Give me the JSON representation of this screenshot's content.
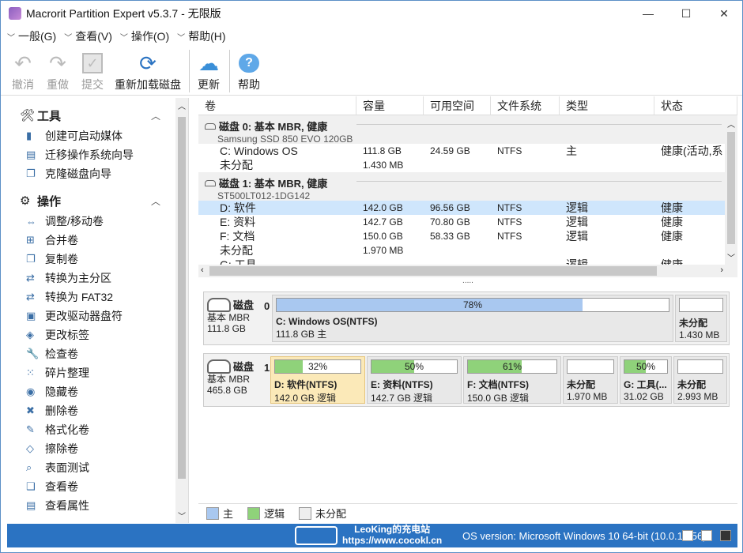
{
  "window": {
    "title": "Macrorit Partition Expert v5.3.7 - 无限版",
    "minimize": "—",
    "maximize": "☐",
    "close": "✕"
  },
  "menu": [
    {
      "label": "一般(G)"
    },
    {
      "label": "查看(V)"
    },
    {
      "label": "操作(O)"
    },
    {
      "label": "帮助(H)"
    }
  ],
  "toolbar": {
    "undo": "撤消",
    "redo": "重做",
    "commit": "提交",
    "reload": "重新加载磁盘",
    "update": "更新",
    "help": "帮助"
  },
  "sidebar": {
    "tools_title": "工具",
    "tools": [
      "创建可启动媒体",
      "迁移操作系统向导",
      "克隆磁盘向导"
    ],
    "ops_title": "操作",
    "ops": [
      "调整/移动卷",
      "合并卷",
      "复制卷",
      "转换为主分区",
      "转换为 FAT32",
      "更改驱动器盘符",
      "更改标签",
      "检查卷",
      "碎片整理",
      "隐藏卷",
      "删除卷",
      "格式化卷",
      "擦除卷",
      "表面测试",
      "查看卷",
      "查看属性"
    ]
  },
  "grid": {
    "headers": [
      "卷",
      "容量",
      "可用空间",
      "文件系统",
      "类型",
      "状态"
    ],
    "disk0": {
      "title": "磁盘  0: 基本 MBR, 健康",
      "model": "Samsung SSD 850 EVO 120GB"
    },
    "disk1": {
      "title": "磁盘  1: 基本 MBR, 健康",
      "model": "ST500LT012-1DG142"
    },
    "rows0": [
      {
        "vol": "C: Windows OS",
        "cap": "111.8 GB",
        "free": "24.59 GB",
        "fs": "NTFS",
        "type": "主",
        "status": "健康(活动,系"
      },
      {
        "vol": "未分配",
        "cap": "1.430 MB",
        "free": "",
        "fs": "",
        "type": "",
        "status": ""
      }
    ],
    "rows1": [
      {
        "vol": "D: 软件",
        "cap": "142.0 GB",
        "free": "96.56 GB",
        "fs": "NTFS",
        "type": "逻辑",
        "status": "健康"
      },
      {
        "vol": "E: 资料",
        "cap": "142.7 GB",
        "free": "70.80 GB",
        "fs": "NTFS",
        "type": "逻辑",
        "status": "健康"
      },
      {
        "vol": "F: 文档",
        "cap": "150.0 GB",
        "free": "58.33 GB",
        "fs": "NTFS",
        "type": "逻辑",
        "status": "健康"
      },
      {
        "vol": "未分配",
        "cap": "1.970 MB",
        "free": "",
        "fs": "",
        "type": "",
        "status": ""
      },
      {
        "vol": "G: 工具",
        "cap": "",
        "free": "",
        "fs": "",
        "type": "逻辑",
        "status": "健康"
      }
    ],
    "splitter": "....."
  },
  "diskmap": {
    "d0": {
      "label": "磁盘",
      "num": "0",
      "kind": "基本 MBR",
      "size": "111.8 GB",
      "parts": [
        {
          "pct": "78%",
          "fill": 0.78,
          "name": "C: Windows OS(NTFS)",
          "sub": "111.8 GB 主",
          "color": "#a9c8f0"
        },
        {
          "pct": "",
          "fill": 0,
          "name": "未分配",
          "sub": "1.430 MB",
          "color": "#fff"
        }
      ]
    },
    "d1": {
      "label": "磁盘",
      "num": "1",
      "kind": "基本 MBR",
      "size": "465.8 GB",
      "parts": [
        {
          "pct": "32%",
          "fill": 0.32,
          "name": "D: 软件(NTFS)",
          "sub": "142.0 GB 逻辑",
          "color": "#8fd27a"
        },
        {
          "pct": "50%",
          "fill": 0.5,
          "name": "E: 资料(NTFS)",
          "sub": "142.7 GB 逻辑",
          "color": "#8fd27a"
        },
        {
          "pct": "61%",
          "fill": 0.61,
          "name": "F: 文档(NTFS)",
          "sub": "150.0 GB 逻辑",
          "color": "#8fd27a"
        },
        {
          "pct": "",
          "fill": 0,
          "name": "未分配",
          "sub": "1.970 MB",
          "color": "#fff"
        },
        {
          "pct": "50%",
          "fill": 0.5,
          "name": "G: 工具(...",
          "sub": "31.02 GB",
          "color": "#8fd27a"
        },
        {
          "pct": "",
          "fill": 0,
          "name": "未分配",
          "sub": "2.993 MB",
          "color": "#fff"
        }
      ]
    }
  },
  "legend": {
    "primary": "主",
    "logical": "逻辑",
    "unalloc": "未分配"
  },
  "status": {
    "brand1": "LeoKing的充电站",
    "brand2": "https://www.cocokl.cn",
    "os": "OS version: Microsoft Windows 10  64-bit  (10.0.1.256)"
  }
}
